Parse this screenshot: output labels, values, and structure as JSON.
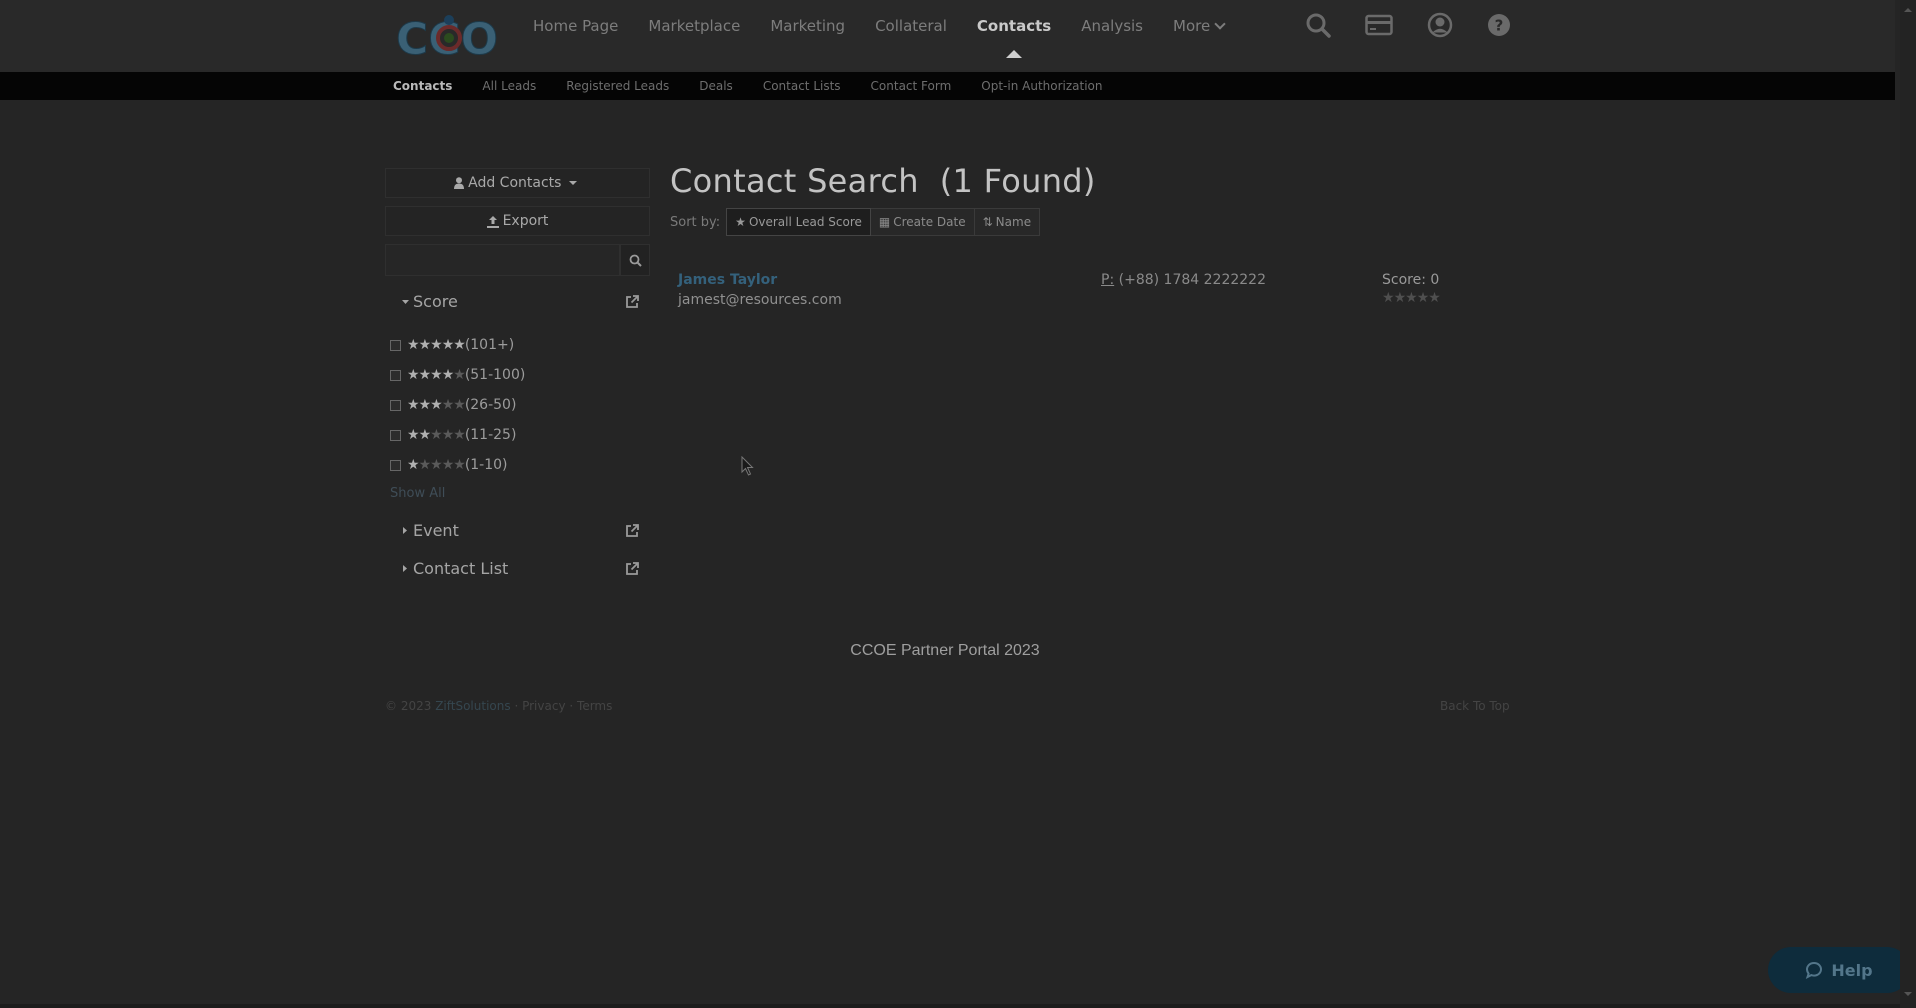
{
  "logo": {
    "text": "CCOE"
  },
  "main_nav": {
    "items": [
      {
        "label": "Home Page",
        "active": false
      },
      {
        "label": "Marketplace",
        "active": false
      },
      {
        "label": "Marketing",
        "active": false
      },
      {
        "label": "Collateral",
        "active": false
      },
      {
        "label": "Contacts",
        "active": true
      },
      {
        "label": "Analysis",
        "active": false
      },
      {
        "label": "More",
        "active": false,
        "has_caret": true
      }
    ],
    "icons": [
      "search-icon",
      "credit-card-icon",
      "user-account-icon",
      "help-circle-icon"
    ]
  },
  "sub_nav": {
    "items": [
      {
        "label": "Contacts",
        "active": true
      },
      {
        "label": "All Leads",
        "active": false
      },
      {
        "label": "Registered Leads",
        "active": false
      },
      {
        "label": "Deals",
        "active": false
      },
      {
        "label": "Contact Lists",
        "active": false
      },
      {
        "label": "Contact Form",
        "active": false
      },
      {
        "label": "Opt-in Authorization",
        "active": false
      }
    ]
  },
  "sidebar": {
    "add_contacts_label": "Add Contacts",
    "export_label": "Export",
    "search": {
      "value": "",
      "placeholder": ""
    },
    "score_section": {
      "title": "Score",
      "expanded": true,
      "options": [
        {
          "stars": 5,
          "range": "(101+)",
          "checked": false
        },
        {
          "stars": 4,
          "range": "(51-100)",
          "checked": false
        },
        {
          "stars": 3,
          "range": "(26-50)",
          "checked": false
        },
        {
          "stars": 2,
          "range": "(11-25)",
          "checked": false
        },
        {
          "stars": 1,
          "range": "(1-10)",
          "checked": false
        }
      ],
      "show_all_label": "Show All"
    },
    "event_section": {
      "title": "Event",
      "expanded": false
    },
    "contact_list_section": {
      "title": "Contact List",
      "expanded": false
    }
  },
  "content": {
    "title": "Contact Search",
    "found": "(1 Found)",
    "sort_label": "Sort by:",
    "sort_options": [
      {
        "label": "Overall Lead Score",
        "icon": "star-icon",
        "active": true
      },
      {
        "label": "Create Date",
        "icon": "calendar-icon",
        "active": false
      },
      {
        "label": "Name",
        "icon": "sort-alpha-icon",
        "active": false
      }
    ],
    "results": [
      {
        "name": "James Taylor",
        "email": "jamest@resources.com",
        "phone_label": "P:",
        "phone": "(+88) 1784 2222222",
        "score_text": "Score: 0",
        "stars": 0
      }
    ]
  },
  "footer": {
    "title": "CCOE Partner Portal 2023",
    "copyright_prefix": "© 2023",
    "brand": "ZiftSolutions",
    "sep": "·",
    "privacy": "Privacy",
    "terms": "Terms",
    "back_to_top": "Back To Top"
  },
  "help_button": {
    "label": "Help"
  },
  "colors": {
    "link": "#34617c",
    "help_bg": "#0e2c3c",
    "subnav_bg": "#050505"
  }
}
